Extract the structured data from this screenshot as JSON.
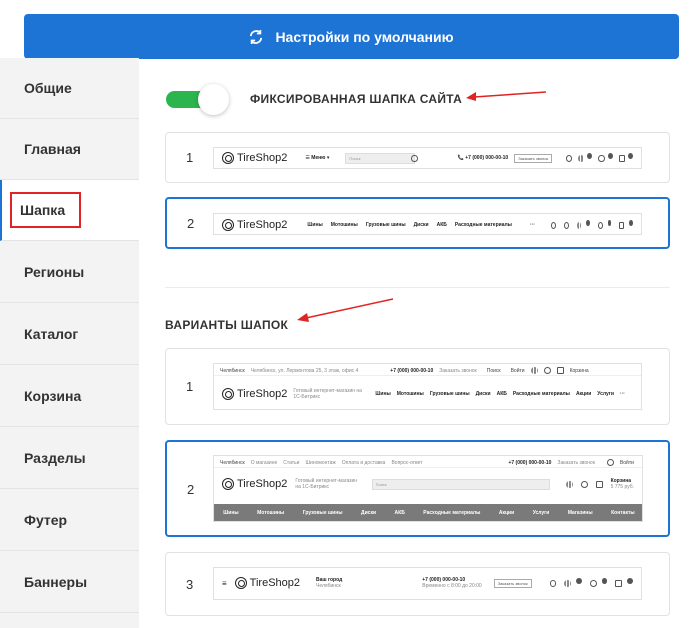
{
  "top_button": {
    "label": "Настройки по умолчанию",
    "icon": "refresh-icon",
    "color": "#1e74d4"
  },
  "sidebar": {
    "items": [
      {
        "label": "Общие"
      },
      {
        "label": "Главная"
      },
      {
        "label": "Шапка",
        "active": true
      },
      {
        "label": "Регионы"
      },
      {
        "label": "Каталог"
      },
      {
        "label": "Корзина"
      },
      {
        "label": "Разделы"
      },
      {
        "label": "Футер"
      },
      {
        "label": "Баннеры"
      }
    ]
  },
  "fixed_header": {
    "toggle_on": true,
    "title": "ФИКСИРОВАННАЯ ШАПКА САЙТА",
    "options": [
      {
        "number": "1",
        "logo": "TireShop2",
        "menu_label": "Меню",
        "search_placeholder": "Поиск",
        "phone": "+7 (000) 000-00-10",
        "callback": "Заказать звонок",
        "compare_count": "0",
        "fav_count": "0",
        "cart_count": "0"
      },
      {
        "number": "2",
        "logo": "TireShop2",
        "nav": [
          "Шины",
          "Мотошины",
          "Грузовые шины",
          "Диски",
          "АКБ",
          "Расходные материалы"
        ],
        "more": "···",
        "compare_count": "0",
        "fav_count": "0",
        "cart_count": "0"
      }
    ]
  },
  "variants": {
    "title": "ВАРИАНТЫ ШАПОК",
    "options": [
      {
        "number": "1",
        "city": "Челябинск",
        "address": "Челябинск, ул. Лермонтова 25, 3 этаж, офис 4",
        "phone": "+7 (000) 000-00-10",
        "callback": "Заказать звонок",
        "search": "Поиск",
        "login": "Войти",
        "cart": "Корзина",
        "logo": "TireShop2",
        "slogan": "Готовый интернет-магазин на 1С-Битрикс",
        "nav": [
          "Шины",
          "Мотошины",
          "Грузовые шины",
          "Диски",
          "АКБ",
          "Расходные материалы",
          "Акции",
          "Услуги"
        ],
        "more": "···"
      },
      {
        "number": "2",
        "city": "Челябинск",
        "links": [
          "О магазине",
          "Статьи",
          "Шиномонтаж",
          "Оплата и доставка",
          "Вопрос-ответ"
        ],
        "phone": "+7 (000) 000-00-10",
        "callback": "Заказать звонок",
        "login": "Войти",
        "logo": "TireShop2",
        "slogan": "Готовый интернет-магазин на 1С-Битрикс",
        "search": "Поиск",
        "cart": "Корзина",
        "cart_sum": "5 775 руб.",
        "nav": [
          "Шины",
          "Мотошины",
          "Грузовые шины",
          "Диски",
          "АКБ",
          "Расходные материалы",
          "Акции",
          "Услуги",
          "Магазины",
          "Контакты"
        ]
      },
      {
        "number": "3",
        "logo": "TireShop2",
        "city_label": "Ваш город",
        "city": "Челябинск",
        "phone": "+7 (000) 000-00-10",
        "hours": "Временно с 8:00 до 20:00",
        "callback": "Заказать звонок"
      }
    ]
  }
}
